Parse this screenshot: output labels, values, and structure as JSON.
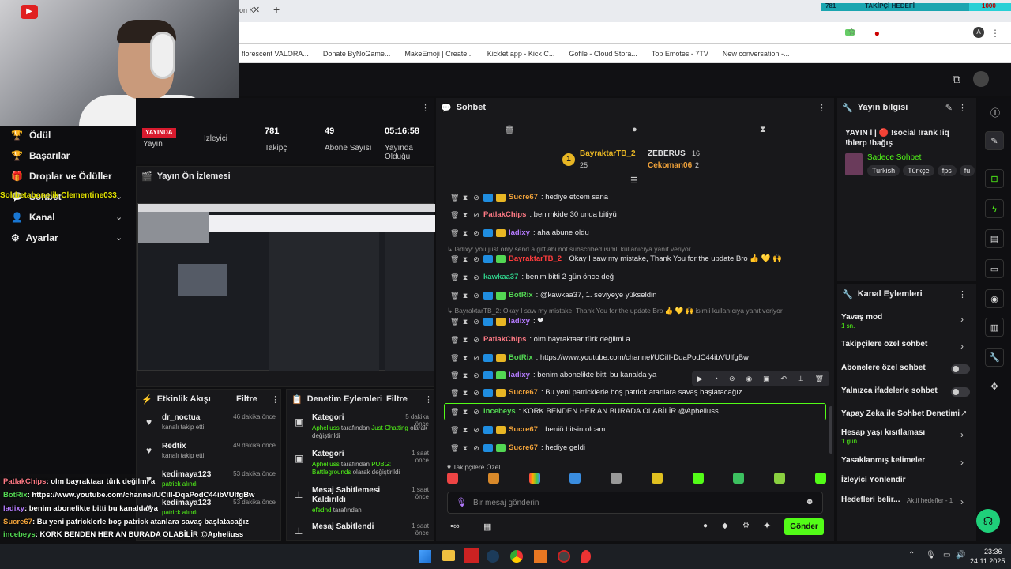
{
  "browser": {
    "tab_title": "on K",
    "close": "✕",
    "new_tab": "+",
    "bookmarks": [
      "florescent VALORA...",
      "Donate ByNoGame...",
      "MakeEmoji | Create...",
      "Kicklet.app - Kick C...",
      "Gofile - Cloud Stora...",
      "Top Emotes - 7TV",
      "New conversation -..."
    ]
  },
  "overlay": {
    "goal_count": "781",
    "goal_title": "TAKİPÇİ HEDEFİ",
    "goal_target": "1000",
    "goal_progress": 0.781,
    "cam_badge": "▶"
  },
  "sidebar": {
    "items": [
      {
        "label": "Ödül",
        "icon": "🏆"
      },
      {
        "label": "Başarılar",
        "icon": "🏆"
      },
      {
        "label": "Droplar ve Ödüller",
        "icon": "🎁"
      },
      {
        "label": "Sohbet",
        "icon": "💬"
      },
      {
        "label": "Kanal",
        "icon": "👤"
      },
      {
        "label": "Ayarlar",
        "icon": "⚙"
      }
    ],
    "overlay_text": "Sohbetabonelik Clementine033"
  },
  "stats": {
    "live_label": "YAYINDA",
    "items": [
      {
        "value": "",
        "label": "Yayın"
      },
      {
        "value": "",
        "label": "İzleyici"
      },
      {
        "value": "781",
        "label": "Takipçi"
      },
      {
        "value": "49",
        "label": "Abone Sayısı"
      },
      {
        "value": "05:16:58",
        "label": "Yayında Olduğu"
      }
    ]
  },
  "preview": {
    "title": "Yayın Ön İzlemesi"
  },
  "activity": {
    "title": "Etkinlik Akışı",
    "filter": "Filtre",
    "items": [
      {
        "name": "dr_noctua",
        "sub": "kanalı takip etti",
        "time": "46 dakika önce"
      },
      {
        "name": "Redtix",
        "sub": "kanalı takip etti",
        "time": "49 dakika önce"
      },
      {
        "name": "kedimaya123",
        "sub": "patrick alındı",
        "time": "53 dakika önce"
      },
      {
        "name": "kedimaya123",
        "sub": "patrick alındı",
        "time": "53 dakika önce"
      }
    ]
  },
  "moderation": {
    "title": "Denetim Eylemleri",
    "filter": "Filtre",
    "items": [
      {
        "title": "Kategori",
        "time": "5 dakika önce",
        "user": "Apheliuss",
        "mid": "tarafından",
        "val": "Just Chatting",
        "sub": "olarak değiştirildi"
      },
      {
        "title": "Kategori",
        "time": "1 saat önce",
        "user": "Apheliuss",
        "mid": "tarafından",
        "val": "PUBG: Battlegrounds",
        "sub": "olarak değiştirildi"
      },
      {
        "title": "Mesaj Sabitlemesi Kaldırıldı",
        "time": "1 saat önce",
        "user": "efednd",
        "mid": "tarafından",
        "val": "",
        "sub": ""
      },
      {
        "title": "Mesaj Sabitlendi",
        "time": "1 saat önce",
        "user": "",
        "mid": "",
        "val": "",
        "sub": ""
      }
    ]
  },
  "chat": {
    "title": "Sohbet",
    "leader": {
      "name": "BayraktarTB_2",
      "count": "25",
      "second": "ZEBERUS",
      "second_count": "16",
      "third": "Cekoman06",
      "third_count": "2",
      "rank": "1"
    },
    "messages": [
      {
        "user": "Sucre67",
        "color": "#f0a23a",
        "text": ": hediye etcem sana"
      },
      {
        "user": "PatlakChips",
        "color": "#ff7a85",
        "text": ": benimkide 30 unda bitiyü"
      },
      {
        "user": "ladixy",
        "color": "#b57bff",
        "text": ": aha abune oldu"
      },
      {
        "user": "BayraktarTB_2",
        "color": "#ff3d3d",
        "text": ": Okay I saw my mistake, Thank You for the update Bro 👍 💛 🙌"
      },
      {
        "user": "kawkaa37",
        "color": "#2fd08a",
        "text": ": benim bitti 2 gün önce değ"
      },
      {
        "user": "BotRix",
        "color": "#53d753",
        "text": ": @kawkaa37, 1. seviyeye yükseldin"
      },
      {
        "user": "ladixy",
        "color": "#b57bff",
        "text": ": ❤"
      },
      {
        "user": "PatlakChips",
        "color": "#ff7a85",
        "text": ": olm bayraktaar türk değilmi a"
      },
      {
        "user": "BotRix",
        "color": "#53d753",
        "text": ": https://www.youtube.com/channel/UCiII-DqaPodC44ibVUlfgBw"
      },
      {
        "user": "ladixy",
        "color": "#b57bff",
        "text": ": benim abonelikte bitti bu kanalda ya"
      },
      {
        "user": "Sucre67",
        "color": "#f0a23a",
        "text": ": Bu yeni patricklerle boş patrick atanlara savaş başlatacağız"
      },
      {
        "user": "incebeys",
        "color": "#53d753",
        "text": ": KORK BENDEN HER AN BURADA OLABİLİR @Apheliuss"
      },
      {
        "user": "Sucre67",
        "color": "#f0a23a",
        "text": ": beniö bitsin olcam"
      },
      {
        "user": "Sucre67",
        "color": "#f0a23a",
        "text": ": hediye geldi"
      }
    ],
    "reply1": "↳ ladixy: you just only send a gift abi not subscribed isimli kullanıcıya yanıt veriyor",
    "reply2": "↳ BayraktarTB_2: Okay I saw my mistake, Thank You for the update Bro 👍 💛 🙌 isimli kullanıcıya yanıt veriyor",
    "followers_only": "♥ Takipçilere Özel",
    "input_placeholder": "Bir mesaj gönderin",
    "send": "Gönder"
  },
  "stream_info": {
    "title": "Yayın bilgisi",
    "stream_title": "YAYIN l | 🔴 !social !rank !iq !blerp !bağış",
    "category": "Sadece Sohbet",
    "tags": [
      "Turkish",
      "Türkçe",
      "fps",
      "fu"
    ]
  },
  "channel_actions": {
    "title": "Kanal Eylemleri",
    "items": [
      {
        "label": "Yavaş mod",
        "sub": "1 sn.",
        "type": "chevron"
      },
      {
        "label": "Takipçilere özel sohbet",
        "sub": "",
        "type": "chevron"
      },
      {
        "label": "Abonelere özel sohbet",
        "sub": "",
        "type": "toggle"
      },
      {
        "label": "Yalnızca ifadelerle sohbet",
        "sub": "",
        "type": "toggle"
      },
      {
        "label": "Yapay Zeka ile Sohbet Denetimi",
        "sub": "",
        "type": "ext"
      },
      {
        "label": "Hesap yaşı kısıtlaması",
        "sub": "1 gün",
        "type": "chevron"
      },
      {
        "label": "Yasaklanmış kelimeler",
        "sub": "",
        "type": "chevron"
      },
      {
        "label": "İzleyici Yönlendir",
        "sub": "",
        "type": "none"
      },
      {
        "label": "Hedefleri belir...",
        "sub": "",
        "type": "goal"
      }
    ],
    "goal_status": "Aktif hedefler - 1"
  },
  "overlay_chat": [
    {
      "user": "PatlakChips",
      "color": "#ff7a85",
      "text": ": olm bayraktaar türk değilmi a"
    },
    {
      "user": "BotRix",
      "color": "#53d753",
      "text": ": https://www.youtube.com/channel/UCiII-DqaPodC44ibVUlfgBw"
    },
    {
      "user": "ladixy",
      "color": "#b57bff",
      "text": ": benim abonelikte bitti bu kanalda ya"
    },
    {
      "user": "Sucre67",
      "color": "#f0a23a",
      "text": ": Bu yeni patricklerle boş patrick atanlara savaş başlatacağız"
    },
    {
      "user": "incebeys",
      "color": "#53d753",
      "text": ": KORK BENDEN HER AN BURADA OLABİLİR @Apheliuss"
    },
    {
      "user": "Sucre67",
      "color": "#f0a23a",
      "text": ": beniö bitsin olcam"
    },
    {
      "user": "Sucre67",
      "color": "#f0a23a",
      "text": ": hediye geldi"
    }
  ],
  "taskbar": {
    "time": "23:36",
    "date": "24.11.2025"
  },
  "colors": {
    "accent": "#53fc18",
    "bg": "#0f0f11",
    "panel": "#18181b"
  }
}
